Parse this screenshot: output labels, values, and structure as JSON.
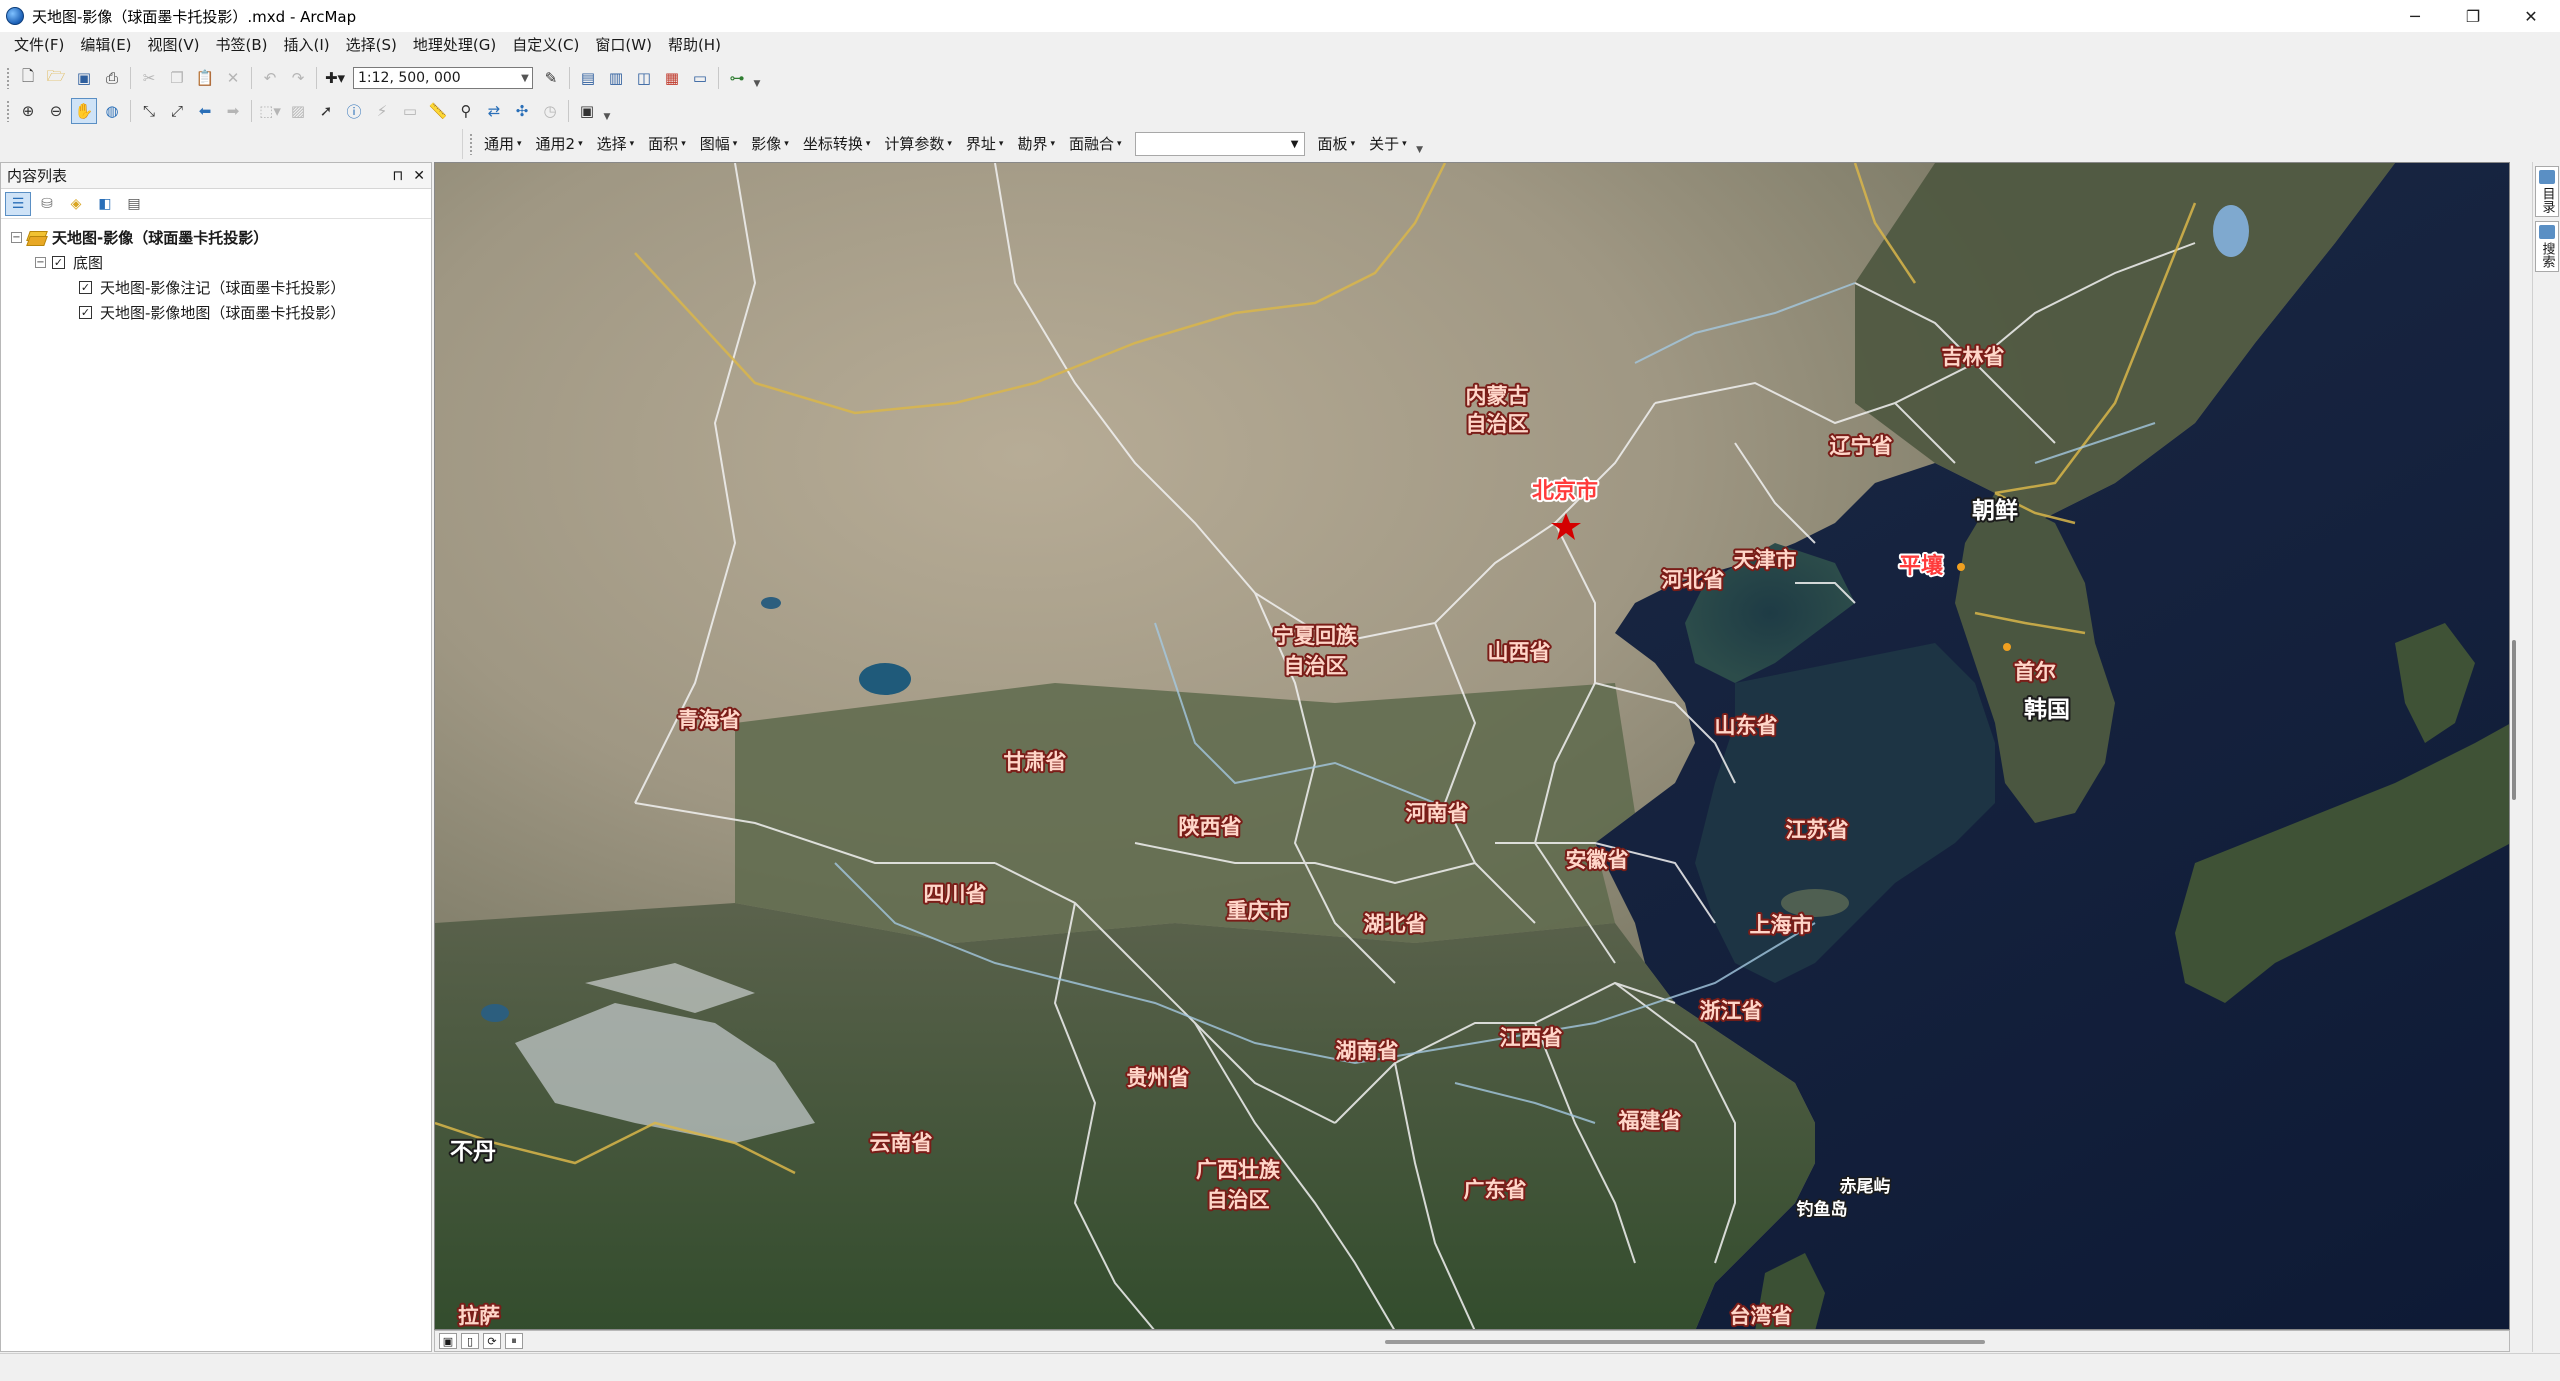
{
  "window": {
    "title": "天地图-影像（球面墨卡托投影）.mxd - ArcMap",
    "minimize": "─",
    "maximize": "❐",
    "close": "✕"
  },
  "menu": [
    "文件(F)",
    "编辑(E)",
    "视图(V)",
    "书签(B)",
    "插入(I)",
    "选择(S)",
    "地理处理(G)",
    "自定义(C)",
    "窗口(W)",
    "帮助(H)"
  ],
  "standard_toolbar": {
    "scale": "1:12, 500, 000"
  },
  "plugin_toolbar": {
    "menus": [
      "通用",
      "通用2",
      "选择",
      "面积",
      "图幅",
      "影像",
      "坐标转换",
      "计算参数",
      "界址",
      "勘界",
      "面融合"
    ],
    "menus_after_combo": [
      "面板",
      "关于"
    ]
  },
  "toc": {
    "title": "内容列表",
    "pin": "⊓",
    "close": "✕",
    "root": "天地图-影像（球面墨卡托投影）",
    "group": "底图",
    "layers": [
      "天地图-影像注记（球面墨卡托投影）",
      "天地图-影像地图（球面墨卡托投影）"
    ]
  },
  "right_strip": {
    "tab1": "目录",
    "tab2": "搜索"
  },
  "map": {
    "capital_marker_color": "#d40000",
    "label_color_province": "#ffd6c9",
    "label_stroke": "#7a1d18",
    "labels": {
      "neimenggu_1": "内蒙古",
      "neimenggu_2": "自治区",
      "jilin": "吉林省",
      "liaoning": "辽宁省",
      "beijing": "北京市",
      "chaoxian": "朝鲜",
      "pingrang": "平壤",
      "tianjin": "天津市",
      "hebei": "河北省",
      "ningxia_1": "宁夏回族",
      "ningxia_2": "自治区",
      "shanxi": "山西省",
      "shouer": "首尔",
      "hanguo": "韩国",
      "qinghai": "青海省",
      "shandong": "山东省",
      "gansu": "甘肃省",
      "henan": "河南省",
      "jiangsu": "江苏省",
      "shaanxi": "陕西省",
      "anhui": "安徽省",
      "sichuan": "四川省",
      "chongqing": "重庆市",
      "hubei": "湖北省",
      "shanghai": "上海市",
      "zhejiang": "浙江省",
      "budan": "不丹",
      "hunan": "湖南省",
      "jiangxi": "江西省",
      "guizhou": "贵州省",
      "chiweiyu": "赤尾屿",
      "diaoyudao": "钓鱼岛",
      "fujian": "福建省",
      "yunnan": "云南省",
      "guangxi_1": "广西壮族",
      "guangxi_2": "自治区",
      "guangdong": "广东省",
      "taiwan": "台湾省",
      "xizang": "拉萨"
    }
  }
}
